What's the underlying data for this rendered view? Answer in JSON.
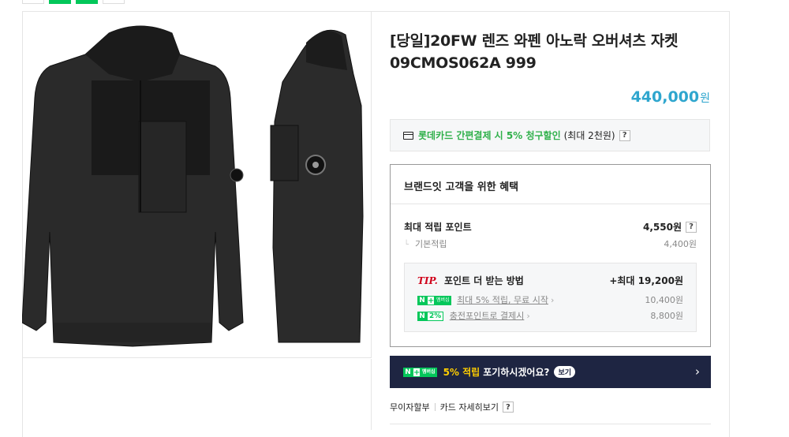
{
  "product": {
    "title": "[당일]20FW 렌즈 와펜 아노락 오버셔츠 자켓09CMOS062A 999",
    "price": "440,000",
    "currency": "원"
  },
  "card_promo": {
    "highlight": "롯데카드 간편결제 시 5% 청구할인",
    "note": "(최대 2천원)",
    "help": "?"
  },
  "benefit": {
    "heading": "브랜드잇 고객을 위한 혜택",
    "max_points_label": "최대 적립 포인트",
    "max_points_value": "4,550원",
    "base_label": "기본적립",
    "base_value": "4,400원",
    "tip": {
      "tip_word": "TIP.",
      "tip_label": "포인트 더 받는 방법",
      "tip_value": "+최대 19,200원",
      "line1_badge_n": "N",
      "line1_badge_plus": "+",
      "line1_badge_mem": "멤버십",
      "line1_label": "최대 5% 적립, 무료 시작",
      "line1_value": "10,400원",
      "line2_badge_n": "N",
      "line2_badge_pct": "2%",
      "line2_label": "충전포인트로 결제시",
      "line2_value": "8,800원"
    }
  },
  "naver_bar": {
    "badge_n": "N",
    "badge_plus": "+",
    "badge_mem": "멤버십",
    "highlight": "5% 적립",
    "text": "포기하시겠어요?",
    "see": "보기",
    "arrow": "›"
  },
  "links": {
    "installment": "무이자할부",
    "card_detail": "카드 자세히보기",
    "help": "?"
  },
  "colors": {
    "price": "#2fa6ce",
    "naver_green": "#03c75a",
    "navy": "#1e2542",
    "tip_red": "#d0021b"
  }
}
